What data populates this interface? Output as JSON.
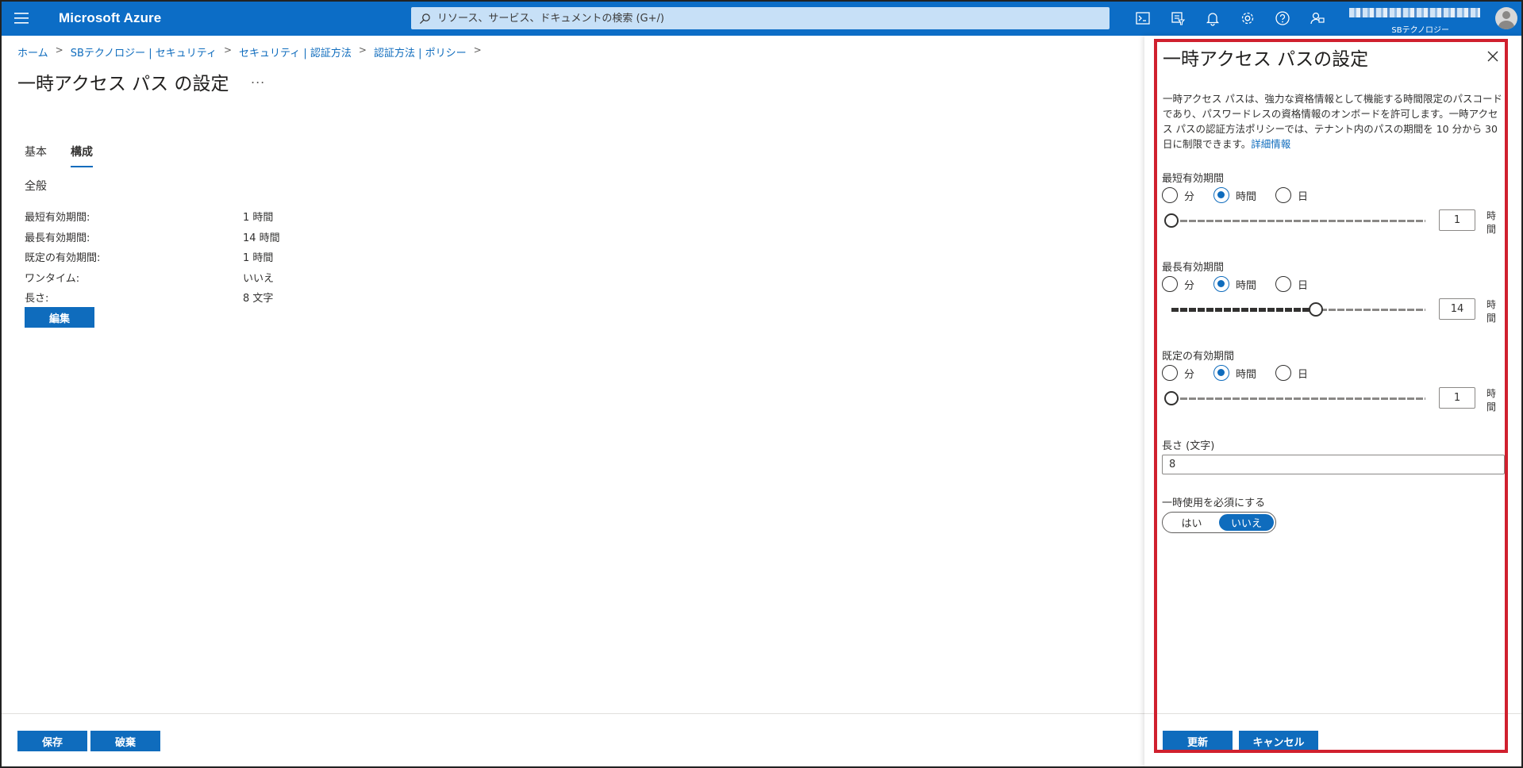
{
  "topbar": {
    "brand": "Microsoft Azure",
    "search_placeholder": "リソース、サービス、ドキュメントの検索 (G+/)",
    "icons": [
      "cloud-shell-icon",
      "directory-filter-icon",
      "bell-icon",
      "gear-icon",
      "help-icon",
      "feedback-icon"
    ],
    "tenant": "SBテクノロジー"
  },
  "breadcrumb": [
    "ホーム",
    "SBテクノロジー | セキュリティ",
    "セキュリティ | 認証方法",
    "認証方法 | ポリシー"
  ],
  "page": {
    "title": "一時アクセス パス の設定",
    "more": "...",
    "tabs": [
      {
        "label": "基本",
        "active": false
      },
      {
        "label": "構成",
        "active": true
      }
    ],
    "section": "全般",
    "properties": [
      {
        "key": "最短有効期間:",
        "value": "1 時間"
      },
      {
        "key": "最長有効期間:",
        "value": "14 時間"
      },
      {
        "key": "既定の有効期間:",
        "value": "1 時間"
      },
      {
        "key": "ワンタイム:",
        "value": "いいえ"
      },
      {
        "key": "長さ:",
        "value": "8 文字"
      }
    ],
    "edit_label": "編集",
    "save_label": "保存",
    "discard_label": "破棄"
  },
  "panel": {
    "title": "一時アクセス パスの設定",
    "description": "一時アクセス パスは、強力な資格情報として機能する時間限定のパスコードであり、パスワードレスの資格情報のオンボードを許可します。一時アクセス パスの認証方法ポリシーでは、テナント内のパスの期間を 10 分から 30 日に制限できます。",
    "learn_more": "詳細情報",
    "unit_options": [
      "分",
      "時間",
      "日"
    ],
    "min_lifetime": {
      "label": "最短有効期間",
      "selected": "時間",
      "value": "1",
      "unit": "時間",
      "slider_fraction": 0.0
    },
    "max_lifetime": {
      "label": "最長有効期間",
      "selected": "時間",
      "value": "14",
      "unit": "時間",
      "slider_fraction": 0.57
    },
    "default_lifetime": {
      "label": "既定の有効期間",
      "selected": "時間",
      "value": "1",
      "unit": "時間",
      "slider_fraction": 0.0
    },
    "length": {
      "label": "長さ (文字)",
      "value": "8"
    },
    "one_time": {
      "label": "一時使用を必須にする",
      "yes": "はい",
      "no": "いいえ",
      "selected": "いいえ"
    },
    "update_label": "更新",
    "cancel_label": "キャンセル"
  }
}
